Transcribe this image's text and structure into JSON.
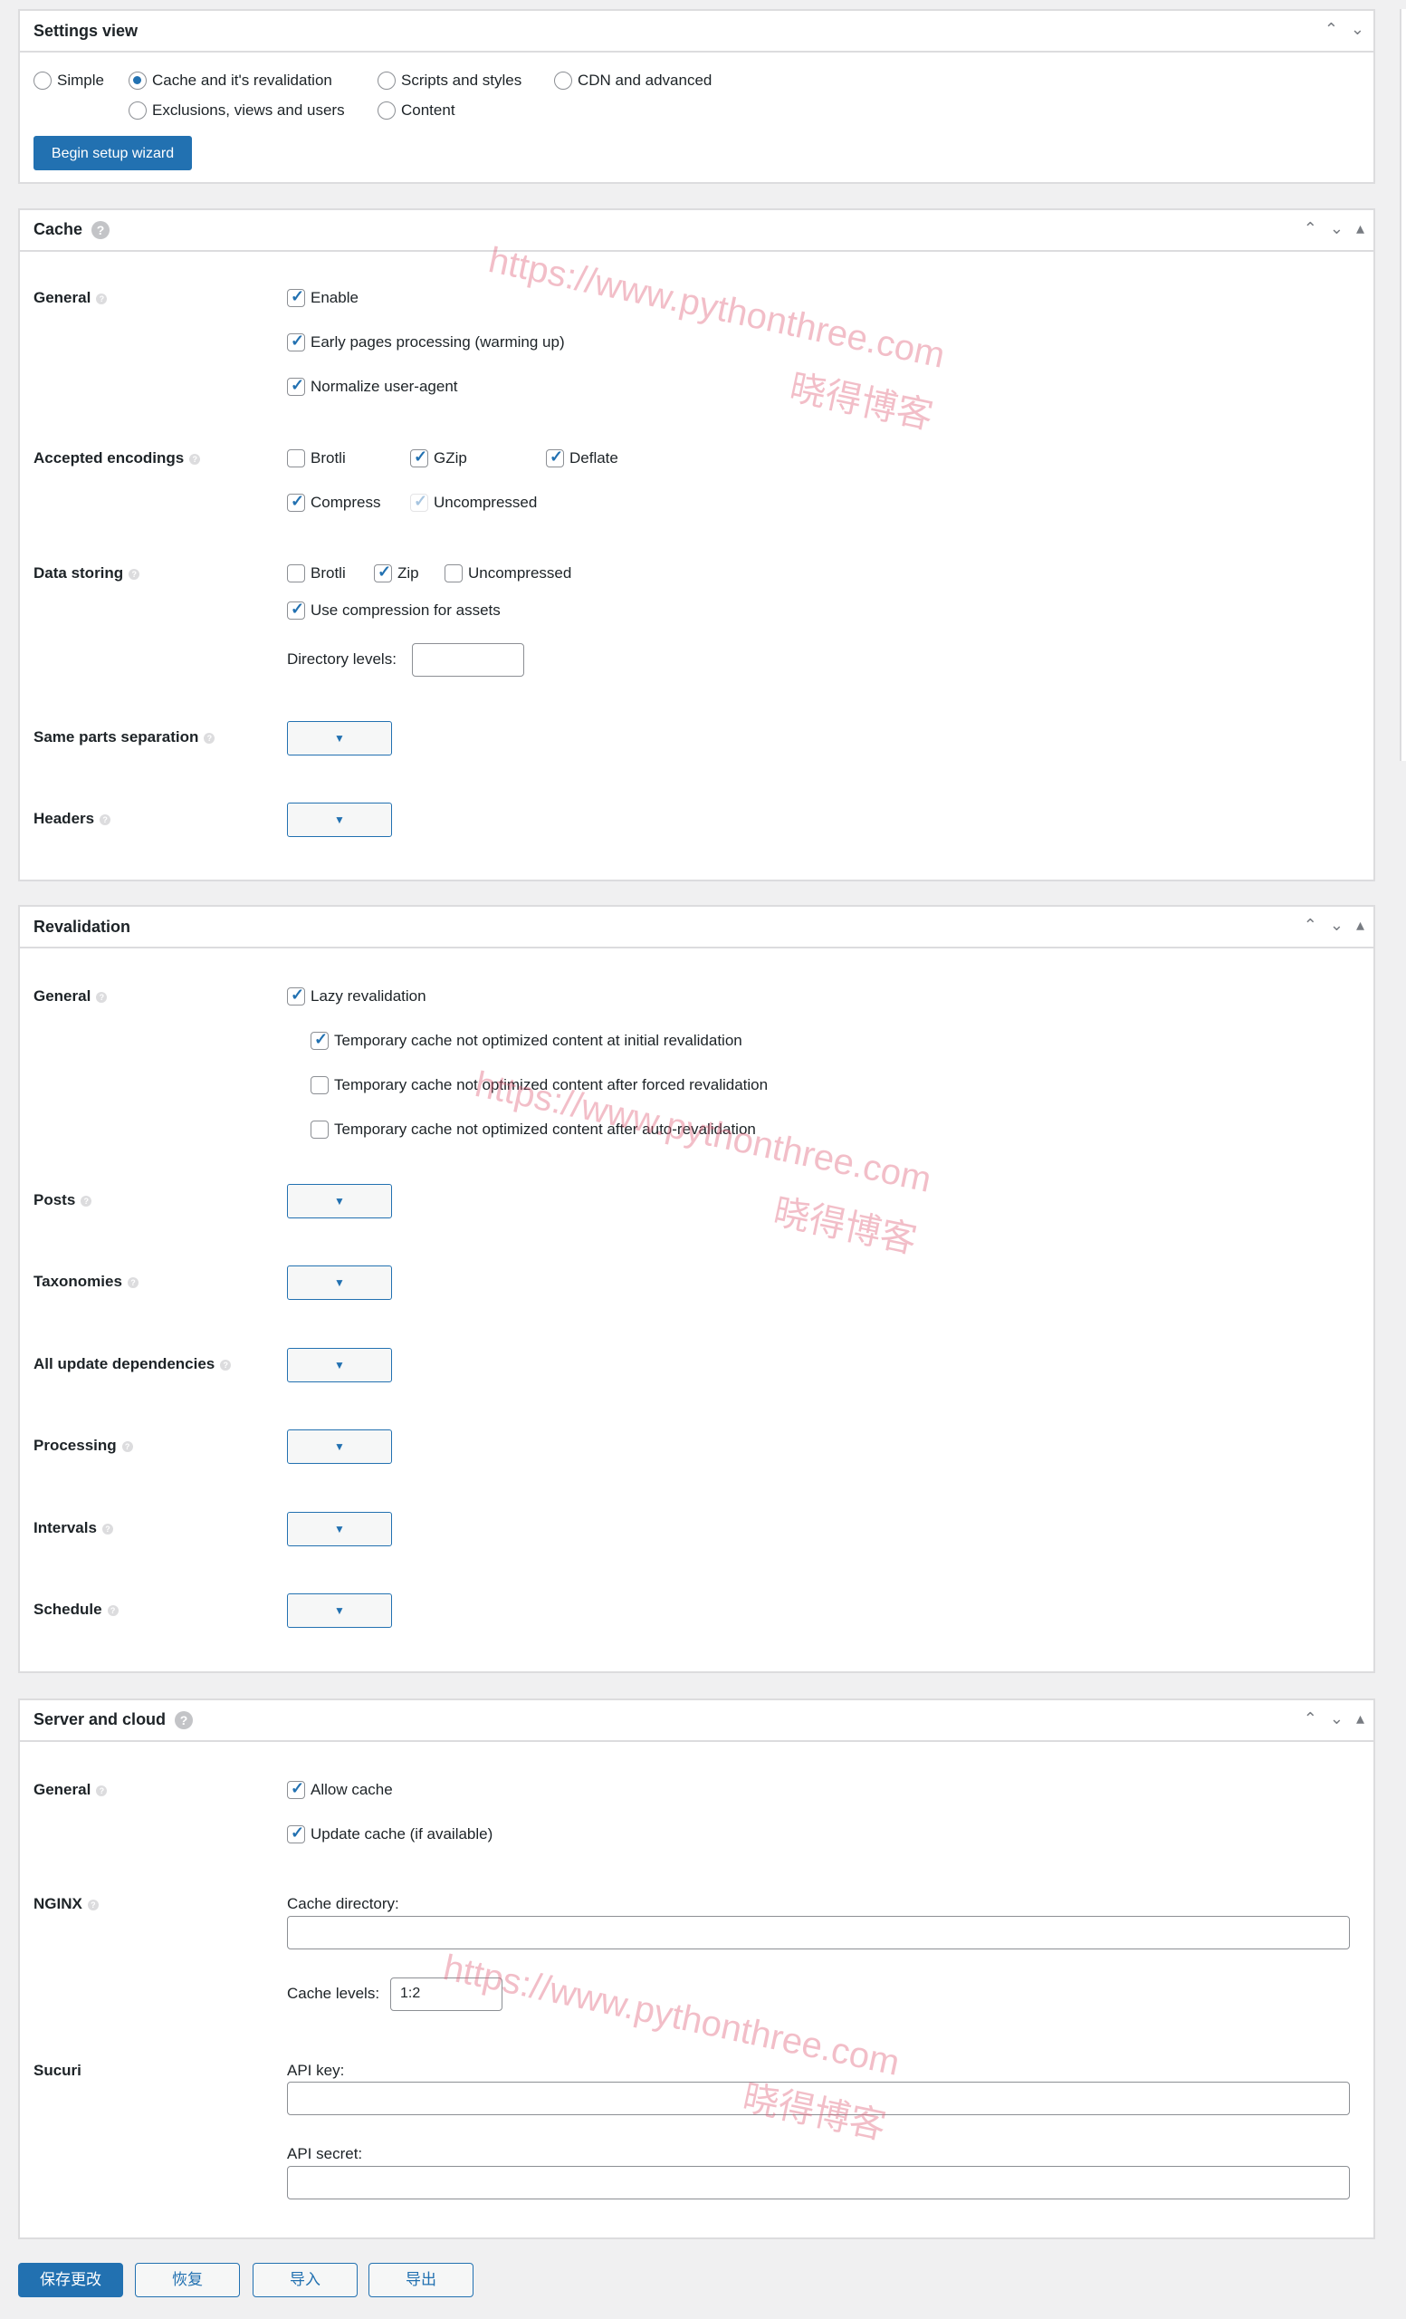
{
  "settings_view": {
    "title": "Settings view",
    "options": [
      {
        "label": "Simple",
        "selected": false
      },
      {
        "label": "Cache and it's revalidation",
        "selected": true
      },
      {
        "label": "Scripts and styles",
        "selected": false
      },
      {
        "label": "CDN and advanced",
        "selected": false
      },
      {
        "label": "Exclusions, views and users",
        "selected": false
      },
      {
        "label": "Content",
        "selected": false
      }
    ],
    "wizard_button": "Begin setup wizard"
  },
  "cache": {
    "title": "Cache",
    "help": "?",
    "general": {
      "label": "General",
      "items": [
        {
          "label": "Enable",
          "checked": true
        },
        {
          "label": "Early pages processing (warming up)",
          "checked": true
        },
        {
          "label": "Normalize user-agent",
          "checked": true
        }
      ]
    },
    "encodings": {
      "label": "Accepted encodings",
      "items": [
        {
          "label": "Brotli",
          "checked": false
        },
        {
          "label": "GZip",
          "checked": true
        },
        {
          "label": "Deflate",
          "checked": true
        },
        {
          "label": "Compress",
          "checked": true
        },
        {
          "label": "Uncompressed",
          "checked": true,
          "disabled": true
        }
      ]
    },
    "storing": {
      "label": "Data storing",
      "items": [
        {
          "label": "Brotli",
          "checked": false
        },
        {
          "label": "Zip",
          "checked": true
        },
        {
          "label": "Uncompressed",
          "checked": false
        },
        {
          "label": "Use compression for assets",
          "checked": true
        }
      ],
      "dir_label": "Directory levels:",
      "dir_value": ""
    },
    "same_parts": {
      "label": "Same parts separation"
    },
    "headers": {
      "label": "Headers"
    }
  },
  "revalidation": {
    "title": "Revalidation",
    "general": {
      "label": "General",
      "items": [
        {
          "label": "Lazy revalidation",
          "checked": true
        },
        {
          "label": "Temporary cache not optimized content at initial revalidation",
          "checked": true
        },
        {
          "label": "Temporary cache not optimized content after forced revalidation",
          "checked": false
        },
        {
          "label": "Temporary cache not optimized content after auto-revalidation",
          "checked": false
        }
      ]
    },
    "dropdowns": [
      "Posts",
      "Taxonomies",
      "All update dependencies",
      "Processing",
      "Intervals",
      "Schedule"
    ]
  },
  "server": {
    "title": "Server and cloud",
    "help": "?",
    "general": {
      "label": "General",
      "items": [
        {
          "label": "Allow cache",
          "checked": true
        },
        {
          "label": "Update cache (if available)",
          "checked": true
        }
      ]
    },
    "nginx": {
      "label": "NGINX",
      "cache_dir_label": "Cache directory:",
      "cache_dir_value": "",
      "levels_label": "Cache levels:",
      "levels_value": "1:2"
    },
    "sucuri": {
      "label": "Sucuri",
      "key_label": "API key:",
      "key_value": "",
      "secret_label": "API secret:",
      "secret_value": ""
    }
  },
  "footer": {
    "save": "保存更改",
    "restore": "恢复",
    "import": "导入",
    "export": "导出"
  },
  "watermark": {
    "url": "https://www.pythonthree.com",
    "name": "晓得博客"
  },
  "colors": {
    "accent": "#2271b1",
    "background": "#f0f0f1"
  }
}
